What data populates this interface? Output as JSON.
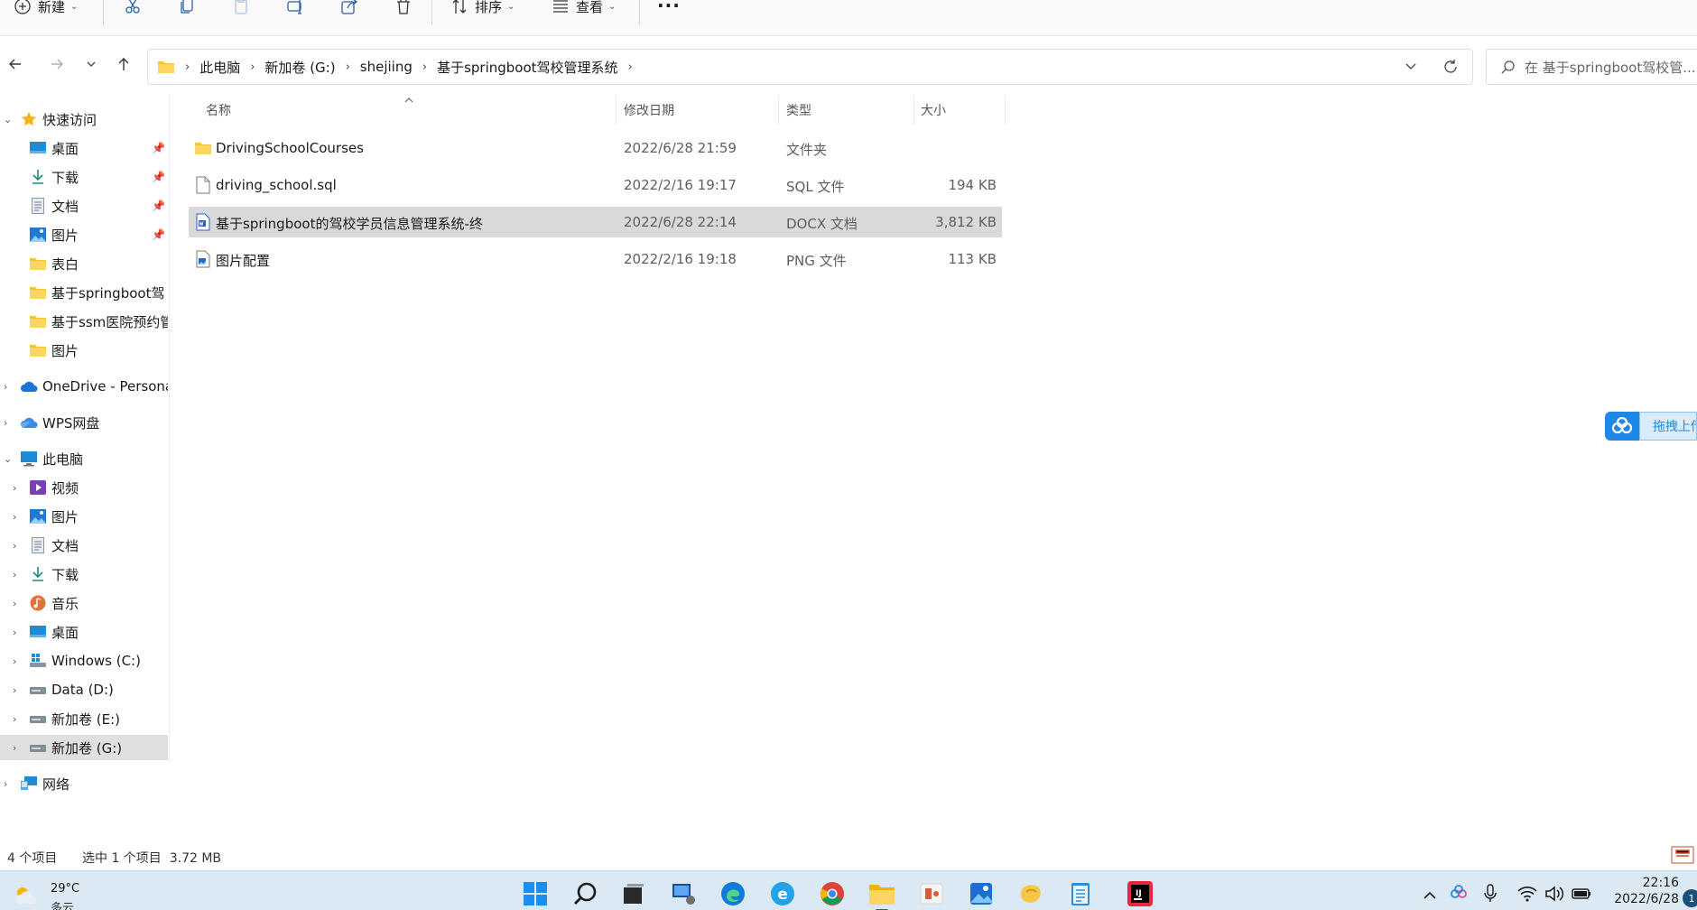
{
  "toolbar": {
    "new_label": "新建",
    "sort_label": "排序",
    "view_label": "查看",
    "more_label": "···"
  },
  "address": {
    "crumbs": [
      "此电脑",
      "新加卷 (G:)",
      "shejiing",
      "基于springboot驾校管理系统"
    ]
  },
  "search": {
    "placeholder": "在 基于springboot驾校管..."
  },
  "sidebar": {
    "quick_access": "快速访问",
    "quick_items": [
      "桌面",
      "下载",
      "文档",
      "图片",
      "表白",
      "基于springboot驾",
      "基于ssm医院预约管",
      "图片"
    ],
    "onedrive": "OneDrive - Persona",
    "wps": "WPS网盘",
    "this_pc": "此电脑",
    "pc_items": [
      "视频",
      "图片",
      "文档",
      "下载",
      "音乐",
      "桌面",
      "Windows (C:)",
      "Data (D:)",
      "新加卷 (E:)",
      "新加卷 (G:)"
    ],
    "network": "网络"
  },
  "columns": {
    "name": "名称",
    "modified": "修改日期",
    "type": "类型",
    "size": "大小"
  },
  "files": [
    {
      "name": "DrivingSchoolCourses",
      "modified": "2022/6/28 21:59",
      "type": "文件夹",
      "size": ""
    },
    {
      "name": "driving_school.sql",
      "modified": "2022/2/16 19:17",
      "type": "SQL 文件",
      "size": "194 KB"
    },
    {
      "name": "基于springboot的驾校学员信息管理系统-终",
      "modified": "2022/6/28 22:14",
      "type": "DOCX 文档",
      "size": "3,812 KB"
    },
    {
      "name": "图片配置",
      "modified": "2022/2/16 19:18",
      "type": "PNG 文件",
      "size": "113 KB"
    }
  ],
  "status": {
    "count": "4 个项目",
    "selected": "选中 1 个项目  3.72 MB"
  },
  "float_widget": {
    "label": "拖拽上传"
  },
  "taskbar": {
    "weather_temp": "29°C",
    "weather_desc": "多云",
    "time": "22:16",
    "date": "2022/6/28",
    "notif_count": "1"
  },
  "colors": {
    "accent": "#0067c0",
    "folder": "#f8c33b",
    "selection": "#d9d9d9",
    "taskbar": "#dbe9f4"
  }
}
